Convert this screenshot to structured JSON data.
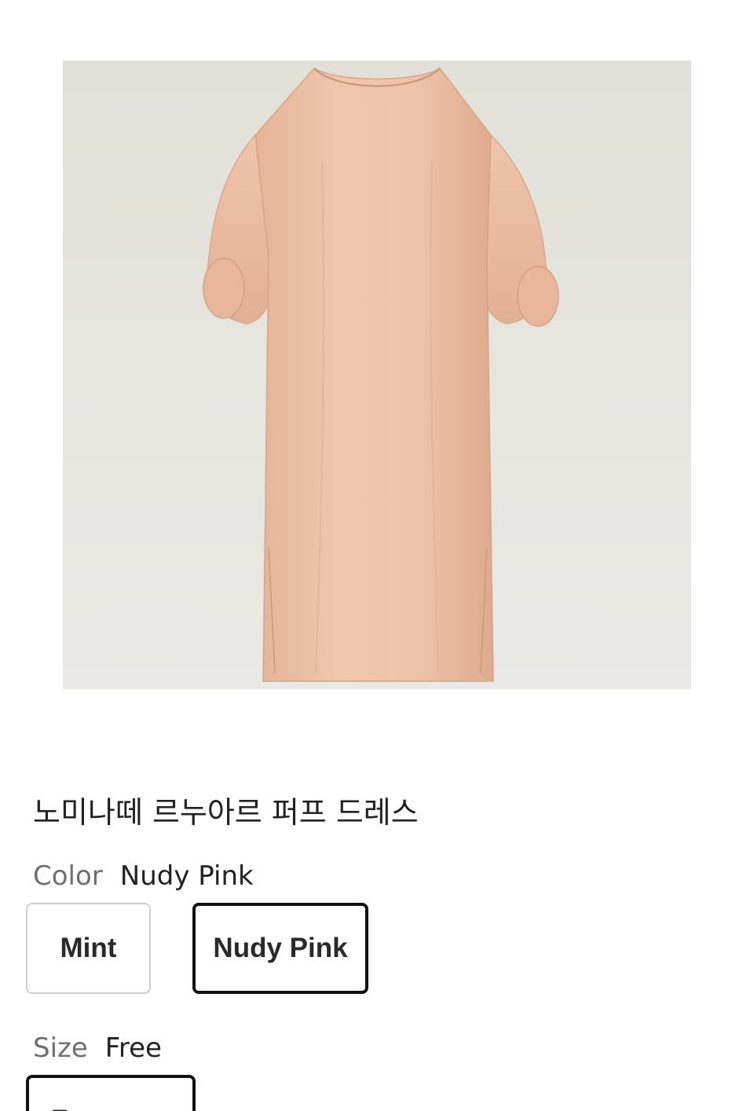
{
  "product": {
    "title": "노미나떼 르누아르 퍼프 드레스",
    "image_colors": {
      "background": "#e5e2dc",
      "dress": "#eec2a8",
      "dress_shadow": "#d9a98e"
    }
  },
  "options": {
    "color": {
      "label": "Color",
      "selected": "Nudy Pink",
      "choices": [
        {
          "label": "Mint",
          "selected": false
        },
        {
          "label": "Nudy Pink",
          "selected": true
        }
      ]
    },
    "size": {
      "label": "Size",
      "selected": "Free",
      "choices": [
        {
          "label": "Free",
          "selected": true
        }
      ]
    }
  }
}
